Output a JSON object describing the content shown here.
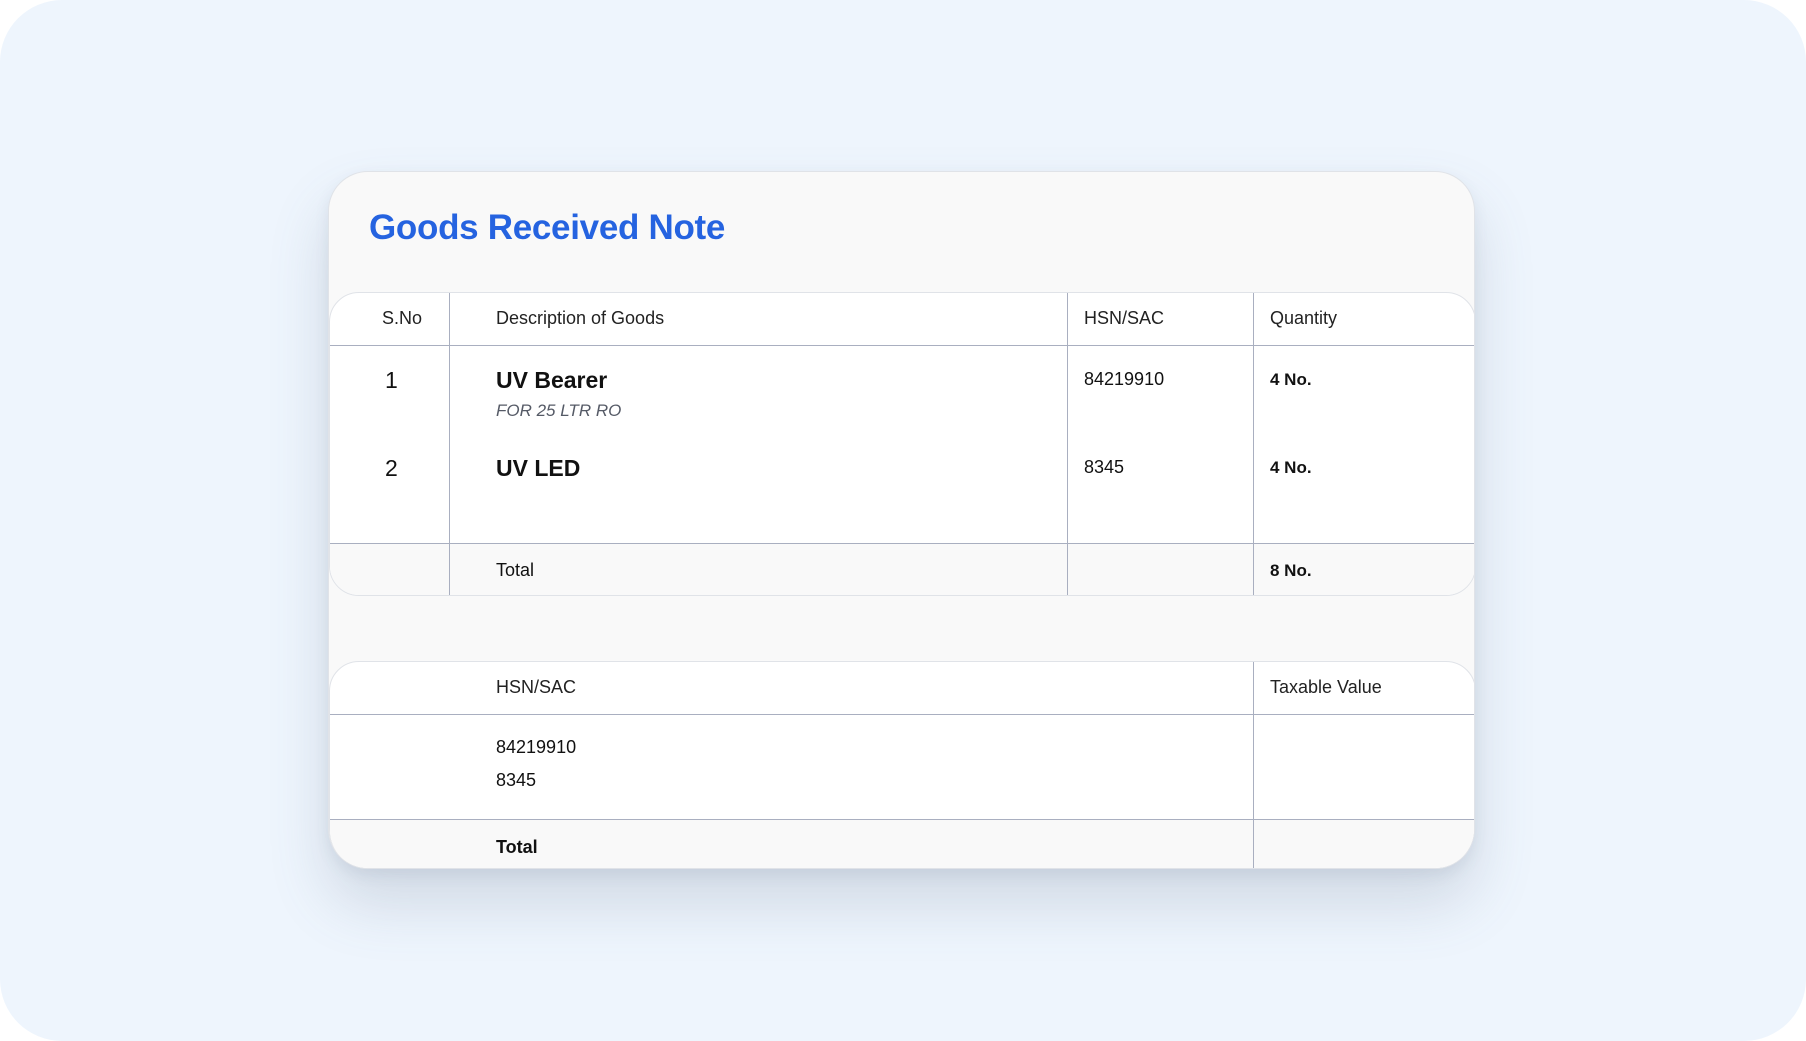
{
  "title": "Goods Received Note",
  "items_table": {
    "headers": {
      "sno": "S.No",
      "description": "Description of Goods",
      "hsn": "HSN/SAC",
      "quantity": "Quantity"
    },
    "rows": [
      {
        "sno": "1",
        "name": "UV Bearer",
        "sub": "FOR 25 LTR RO",
        "hsn": "84219910",
        "quantity": "4 No."
      },
      {
        "sno": "2",
        "name": "UV LED",
        "sub": "",
        "hsn": "8345",
        "quantity": "4 No."
      }
    ],
    "total": {
      "label": "Total",
      "quantity": "8 No."
    }
  },
  "tax_table": {
    "headers": {
      "hsn": "HSN/SAC",
      "taxable_value": "Taxable Value"
    },
    "rows": [
      {
        "hsn": "84219910",
        "taxable_value": ""
      },
      {
        "hsn": "8345",
        "taxable_value": ""
      }
    ],
    "total": {
      "label": "Total",
      "taxable_value": ""
    }
  },
  "colors": {
    "title": "#2563e0",
    "backdrop": "#eef5fd",
    "card": "#f9f9f9",
    "grid_lines": "#a9afc0"
  }
}
